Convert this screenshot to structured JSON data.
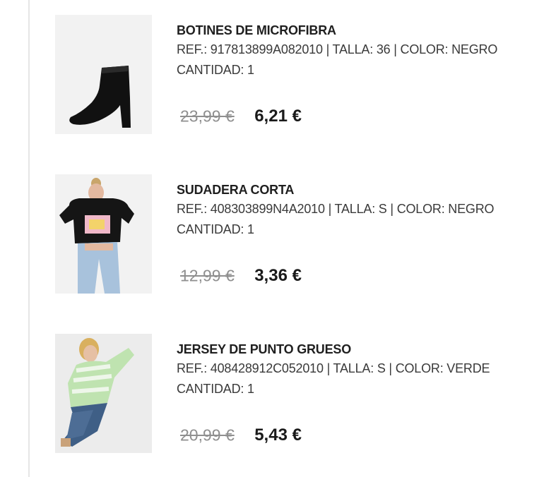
{
  "items": [
    {
      "name": "BOTINES DE MICROFIBRA",
      "ref": "REF.: 917813899A082010 | TALLA: 36 | COLOR: NEGRO",
      "qty": "CANTIDAD: 1",
      "old_price": "23,99 €",
      "new_price": "6,21 €",
      "image_icon": "ankle-boot-icon"
    },
    {
      "name": "SUDADERA CORTA",
      "ref": "REF.: 408303899N4A2010 | TALLA: S | COLOR: NEGRO",
      "qty": "CANTIDAD: 1",
      "old_price": "12,99 €",
      "new_price": "3,36 €",
      "image_icon": "cropped-sweatshirt-model-icon"
    },
    {
      "name": "JERSEY DE PUNTO GRUESO",
      "ref": "REF.: 408428912C052010 | TALLA: S | COLOR: VERDE",
      "qty": "CANTIDAD: 1",
      "old_price": "20,99 €",
      "new_price": "5,43 €",
      "image_icon": "knit-sweater-model-icon"
    }
  ],
  "colors": {
    "old_price": "#8f8f8f",
    "new_price": "#1a1a1a",
    "divider": "#e6e6e6"
  }
}
